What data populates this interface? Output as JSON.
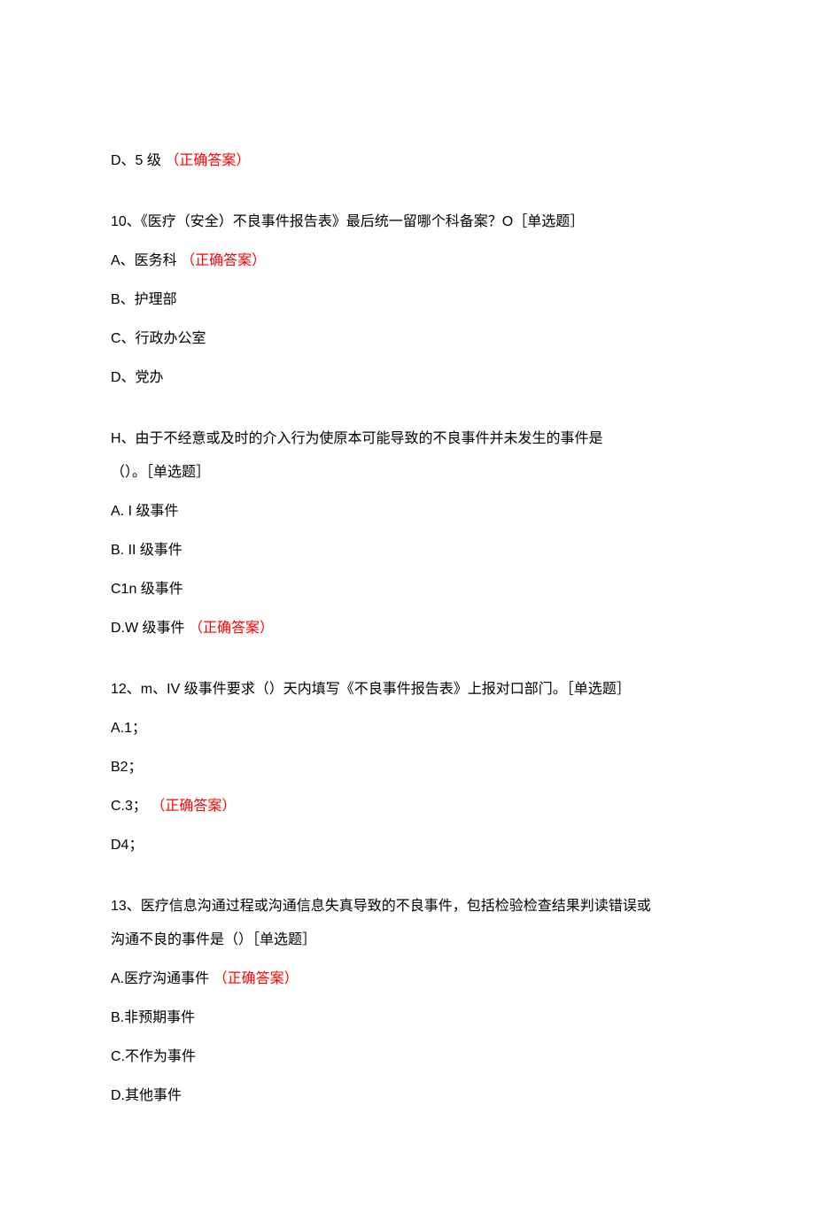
{
  "correct_label": "（正确答案）",
  "q9_trailing": {
    "text_pre": "D、5 级 "
  },
  "q10": {
    "stem": "10、《医疗（安全）不良事件报告表》最后统一留哪个科备案？O［单选题］",
    "a_pre": "A、医务科 ",
    "b": "B、护理部",
    "c": "C、行政办公室",
    "d": "D、党办"
  },
  "q11": {
    "stem1": "H、由于不经意或及时的介入行为使原本可能导致的不良事件并未发生的事件是",
    "stem2": "（）。［单选题］",
    "a": "A.   I 级事件",
    "b": "B.   II 级事件",
    "c": "C1n 级事件",
    "d_pre": "D.W 级事件 "
  },
  "q12": {
    "stem": "12、m、IV 级事件要求（）天内填写《不良事件报告表》上报对口部门。［单选题］",
    "a": "A.1；",
    "b": "B2；",
    "c_pre": "C.3； ",
    "d": "D4；"
  },
  "q13": {
    "stem1": "13、医疗信息沟通过程或沟通信息失真导致的不良事件，包括检验检查结果判读错误或",
    "stem2": "沟通不良的事件是（）［单选题］",
    "a_pre": "A.医疗沟通事件 ",
    "b": "B.非预期事件",
    "c": "C.不作为事件",
    "d": "D.其他事件"
  }
}
